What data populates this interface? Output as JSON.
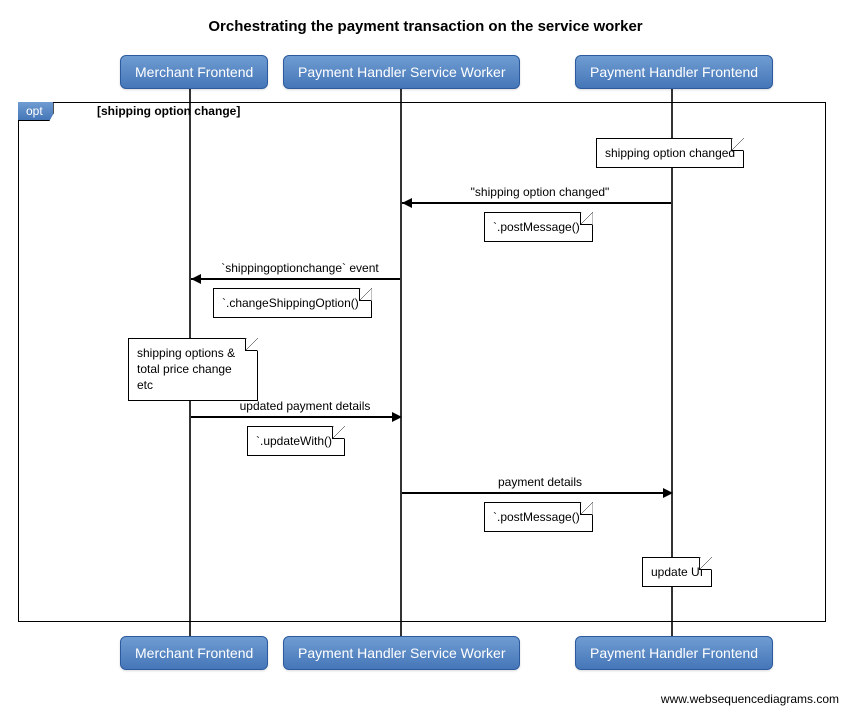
{
  "title": "Orchestrating the payment transaction on the service worker",
  "participants": {
    "merchant": "Merchant Frontend",
    "sw": "Payment Handler Service Worker",
    "phfrontend": "Payment Handler Frontend"
  },
  "opt": {
    "label": "opt",
    "guard": "[shipping option change]"
  },
  "notes": {
    "shipping_changed": "shipping option changed",
    "post_message_1": "`.postMessage()`",
    "change_shipping": "`.changeShippingOption()`",
    "options_price": "shipping options & total price change etc",
    "update_with": "`.updateWith()`",
    "post_message_2": "`.postMessage()`",
    "update_ui": "update UI"
  },
  "messages": {
    "shipping_option_changed": "\"shipping option changed\"",
    "shippingoptionchange_event": "`shippingoptionchange` event",
    "updated_payment_details": "updated payment details",
    "payment_details": "payment details"
  },
  "footer": "www.websequencediagrams.com",
  "chart_data": {
    "type": "sequence-diagram",
    "title": "Orchestrating the payment transaction on the service worker",
    "participants": [
      "Merchant Frontend",
      "Payment Handler Service Worker",
      "Payment Handler Frontend"
    ],
    "fragment": {
      "type": "opt",
      "guard": "shipping option change"
    },
    "steps": [
      {
        "kind": "note",
        "over": "Payment Handler Frontend",
        "text": "shipping option changed"
      },
      {
        "kind": "message",
        "from": "Payment Handler Frontend",
        "to": "Payment Handler Service Worker",
        "label": "\"shipping option changed\"",
        "note": "`.postMessage()`"
      },
      {
        "kind": "message",
        "from": "Payment Handler Service Worker",
        "to": "Merchant Frontend",
        "label": "`shippingoptionchange` event",
        "note": "`.changeShippingOption()`"
      },
      {
        "kind": "note",
        "over": "Merchant Frontend",
        "text": "shipping options & total price change etc"
      },
      {
        "kind": "message",
        "from": "Merchant Frontend",
        "to": "Payment Handler Service Worker",
        "label": "updated payment details",
        "note": "`.updateWith()`"
      },
      {
        "kind": "message",
        "from": "Payment Handler Service Worker",
        "to": "Payment Handler Frontend",
        "label": "payment details",
        "note": "`.postMessage()`"
      },
      {
        "kind": "note",
        "over": "Payment Handler Frontend",
        "text": "update UI"
      }
    ]
  }
}
